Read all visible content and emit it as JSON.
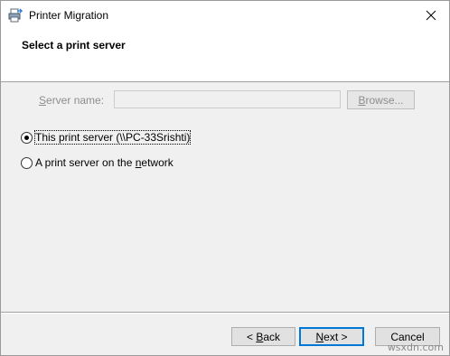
{
  "window": {
    "title": "Printer Migration"
  },
  "header": {
    "title": "Select a print server"
  },
  "options": {
    "this_server": {
      "label": "This print server (\\\\PC-33Srishti)",
      "checked": true
    },
    "network_server": {
      "pre": "A print server on the ",
      "underline": "n",
      "post": "etwork",
      "checked": false
    }
  },
  "server_name": {
    "underline": "S",
    "rest": "erver name:",
    "value": ""
  },
  "browse": {
    "underline": "B",
    "rest": "rowse..."
  },
  "footer": {
    "back_prefix": "< ",
    "back_underline": "B",
    "back_rest": "ack",
    "next_underline": "N",
    "next_rest": "ext >",
    "cancel": "Cancel"
  },
  "watermark": "wsxdn.com",
  "icons": {
    "app": "printer-migration-icon",
    "close": "close-icon"
  }
}
